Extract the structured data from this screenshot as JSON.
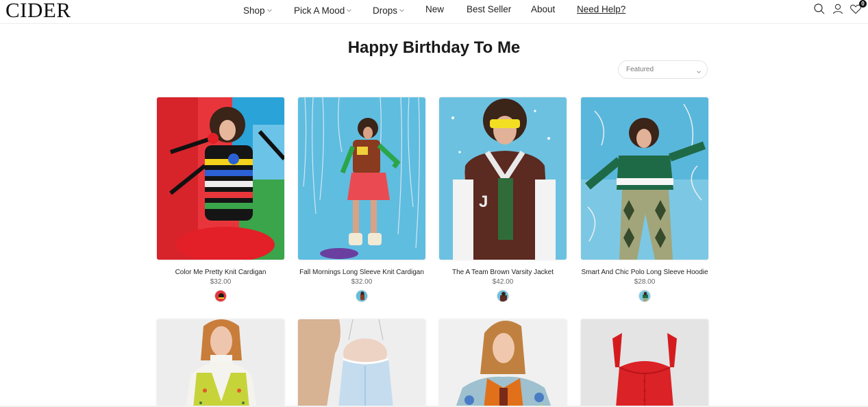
{
  "header": {
    "logo": "CIDER",
    "nav": [
      {
        "label": "Shop",
        "caret": true
      },
      {
        "label": "Pick A Mood",
        "caret": true
      },
      {
        "label": "Drops",
        "caret": true
      },
      {
        "label": "New",
        "caret": false
      },
      {
        "label": "Best Seller",
        "caret": false
      },
      {
        "label": "About",
        "caret": false
      },
      {
        "label": "Need Help?",
        "caret": false
      }
    ],
    "wishlist_count": "0",
    "cart_count": "0"
  },
  "page": {
    "title": "Happy Birthday To Me",
    "sort_selected": "Featured"
  },
  "products": [
    {
      "name": "Color Me Pretty Knit Cardigan",
      "price": "$32.00"
    },
    {
      "name": "Fall Mornings Long Sleeve Knit Cardigan",
      "price": "$32.00"
    },
    {
      "name": "The A Team Brown Varsity Jacket",
      "price": "$42.00"
    },
    {
      "name": "Smart And Chic Polo Long Sleeve Hoodie",
      "price": "$28.00"
    }
  ],
  "colors": {
    "accent": "#111111",
    "border": "#ececec"
  }
}
